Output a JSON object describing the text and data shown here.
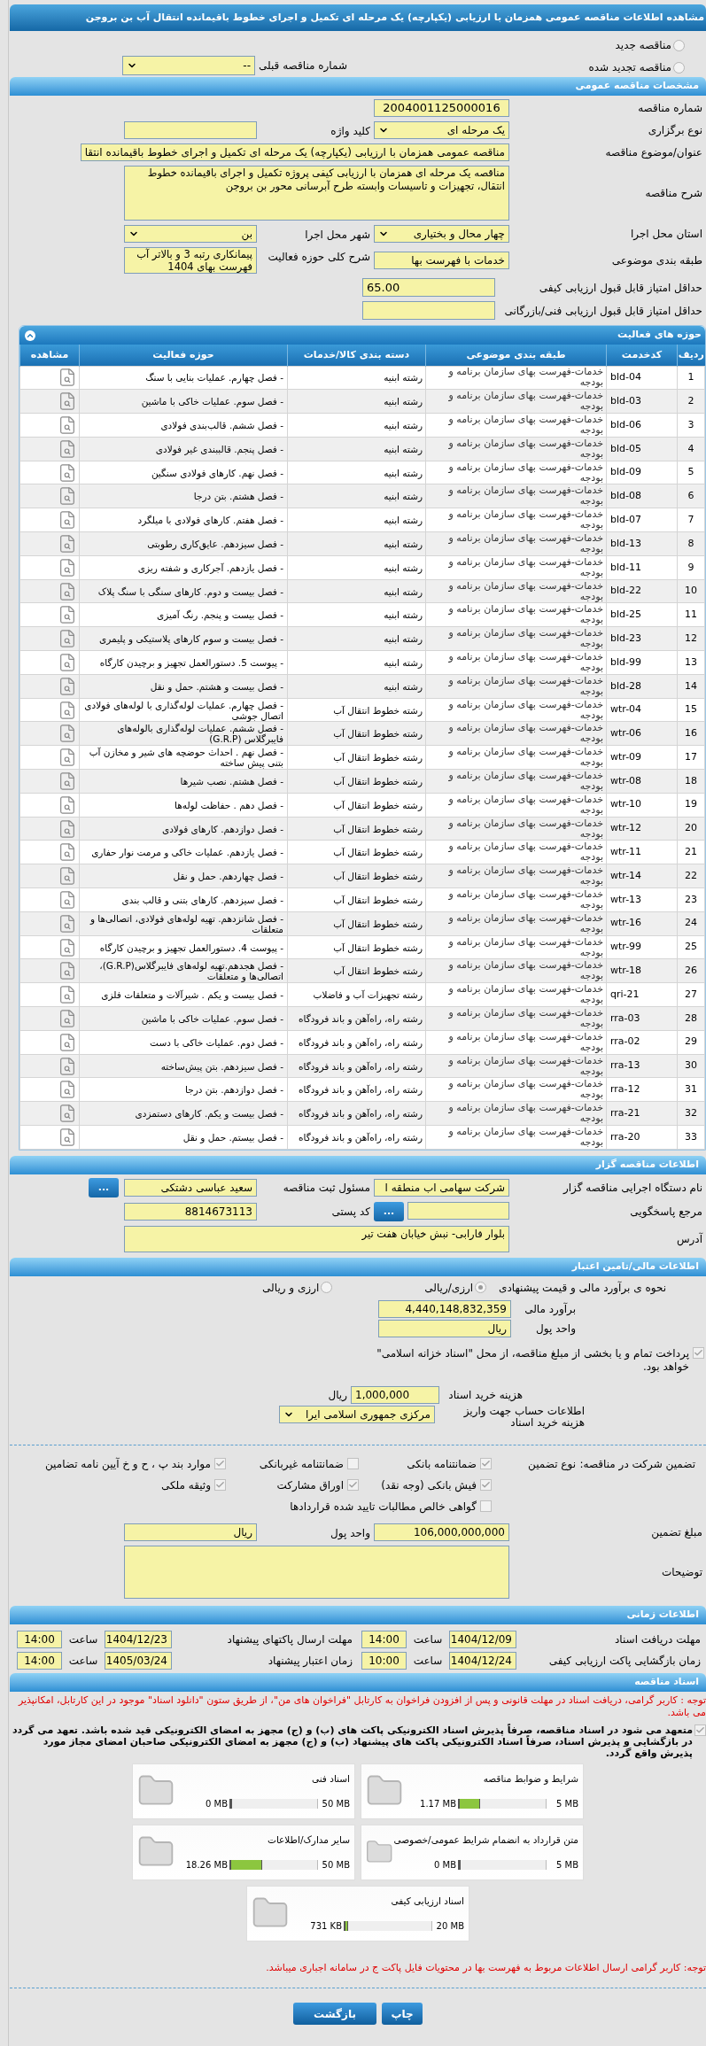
{
  "title": "مشاهده اطلاعات مناقصه عمومی همزمان با ارزیابی (یکپارچه) یک مرحله ای تکمیل و اجرای خطوط باقیمانده انتقال آب بن بروجن",
  "tender_type": [
    {
      "label": "مناقصه جدید",
      "selected": false
    },
    {
      "label": "مناقصه تجدید شده",
      "selected": false
    }
  ],
  "previous_tender": {
    "label": "شماره مناقصه قبلی",
    "value": "--"
  },
  "general": {
    "header": "مشخصات مناقصه عمومی",
    "rows": [
      [
        {
          "label": "شماره مناقصه",
          "kind": "code",
          "value": "2004001125000016"
        }
      ],
      [
        {
          "label": "نوع برگزاری",
          "kind": "select",
          "value": "یک مرحله ای"
        },
        {
          "label": "کلید واژه",
          "kind": "text"
        }
      ],
      [
        {
          "label": "عنوان/موضوع مناقصه",
          "kind": "long",
          "value": "مناقصه عمومی همزمان با ارزیابی (یکپارچه) یک مرحله ای تکمیل و اجرای خطوط باقیمانده انتقا"
        }
      ],
      [
        {
          "label": "شرح مناقصه",
          "kind": "textarea",
          "value": "مناقصه یک مرحله ای همزمان با ارزیابی کیفی پروژه تکمیل و اجرای باقیمانده خطوط انتقال، تجهیزات و تاسیسات وابسته طرح آبرسانی محور بن بروجن"
        }
      ],
      [
        {
          "label": "استان محل اجرا",
          "kind": "select",
          "value": "چهار محال و بختیاری"
        },
        {
          "label": "شهر محل اجرا",
          "kind": "select",
          "value": "بن"
        }
      ],
      [
        {
          "label": "طبقه بندی موضوعی",
          "kind": "text",
          "value": "خدمات با فهرست بها"
        },
        {
          "label": "شرح کلی حوزه فعالیت",
          "kind": "note",
          "value": "پیمانکاری رتبه 3 و بالاتر آب فهرست بهای 1404"
        }
      ],
      [
        {
          "label": "حداقل امتیاز قابل قبول ارزیابی کیفی",
          "kind": "score",
          "value": "65.00"
        }
      ],
      [
        {
          "label": "حداقل امتیاز قابل قبول ارزیابی فنی/بازرگانی",
          "kind": "score"
        }
      ]
    ]
  },
  "activities": {
    "header": "حوزه های فعالیت",
    "columns": [
      "ردیف",
      "کدخدمت",
      "طبقه بندی موضوعی",
      "دسته بندی کالا/خدمات",
      "حوزه فعالیت",
      "مشاهده"
    ],
    "rows": [
      [
        "1",
        "bld-04",
        "خدمات-فهرست بهای سازمان برنامه و بودجه",
        "رشته ابنیه",
        "- فصل چهارم. عملیات بنایی با سنگ"
      ],
      [
        "2",
        "bld-03",
        "خدمات-فهرست بهای سازمان برنامه و بودجه",
        "رشته ابنیه",
        "- فصل سوم. عملیات خاکی با ماشین"
      ],
      [
        "3",
        "bld-06",
        "خدمات-فهرست بهای سازمان برنامه و بودجه",
        "رشته ابنیه",
        "- فصل ششم. قالب‌بندی فولادی"
      ],
      [
        "4",
        "bld-05",
        "خدمات-فهرست بهای سازمان برنامه و بودجه",
        "رشته ابنیه",
        "- فصل پنجم. قالببندی غیر فولادی"
      ],
      [
        "5",
        "bld-09",
        "خدمات-فهرست بهای سازمان برنامه و بودجه",
        "رشته ابنیه",
        "- فصل نهم. کارهای فولادی سنگین"
      ],
      [
        "6",
        "bld-08",
        "خدمات-فهرست بهای سازمان برنامه و بودجه",
        "رشته ابنیه",
        "- فصل هشتم. بتن درجا"
      ],
      [
        "7",
        "bld-07",
        "خدمات-فهرست بهای سازمان برنامه و بودجه",
        "رشته ابنیه",
        "- فصل هفتم. کارهای فولادی با میلگرد"
      ],
      [
        "8",
        "bld-13",
        "خدمات-فهرست بهای سازمان برنامه و بودجه",
        "رشته ابنیه",
        "- فصل سیزدهم. عایق‌کاری رطوبتی"
      ],
      [
        "9",
        "bld-11",
        "خدمات-فهرست بهای سازمان برنامه و بودجه",
        "رشته ابنیه",
        "- فصل یازدهم. آجرکاری و شفته ریزی"
      ],
      [
        "10",
        "bld-22",
        "خدمات-فهرست بهای سازمان برنامه و بودجه",
        "رشته ابنیه",
        "- فصل بیست و دوم. کارهای سنگی با سنگ پلاک"
      ],
      [
        "11",
        "bld-25",
        "خدمات-فهرست بهای سازمان برنامه و بودجه",
        "رشته ابنیه",
        "- فصل بیست و پنجم. رنگ آمیزی"
      ],
      [
        "12",
        "bld-23",
        "خدمات-فهرست بهای سازمان برنامه و بودجه",
        "رشته ابنیه",
        "- فصل بیست و سوم کارهای پلاستیکی و پلیمری"
      ],
      [
        "13",
        "bld-99",
        "خدمات-فهرست بهای سازمان برنامه و بودجه",
        "رشته ابنیه",
        "- پیوست 5. دستورالعمل تجهیز و برچیدن کارگاه"
      ],
      [
        "14",
        "bld-28",
        "خدمات-فهرست بهای سازمان برنامه و بودجه",
        "رشته ابنیه",
        "- فصل بیست و هشتم. حمل و نقل"
      ],
      [
        "15",
        "wtr-04",
        "خدمات-فهرست بهای سازمان برنامه و بودجه",
        "رشته خطوط انتقال آب",
        "- فصل چهارم. عملیات لوله‌گذاری با لوله‌های فولادی اتصال جوشی"
      ],
      [
        "16",
        "wtr-06",
        "خدمات-فهرست بهای سازمان برنامه و بودجه",
        "رشته خطوط انتقال آب",
        "- فصل ششم. عملیات لوله‌گذاری بالوله‌های فایبرگلاس (G.R.P)"
      ],
      [
        "17",
        "wtr-09",
        "خدمات-فهرست بهای سازمان برنامه و بودجه",
        "رشته خطوط انتقال آب",
        "- فصل نهم . احداث حوضچه های شیر و مخازن آب بتنی پیش ساخته"
      ],
      [
        "18",
        "wtr-08",
        "خدمات-فهرست بهای سازمان برنامه و بودجه",
        "رشته خطوط انتقال آب",
        "- فصل هشتم. نصب شیرها"
      ],
      [
        "19",
        "wtr-10",
        "خدمات-فهرست بهای سازمان برنامه و بودجه",
        "رشته خطوط انتقال آب",
        "- فصل دهم . حفاظت لوله‌ها"
      ],
      [
        "20",
        "wtr-12",
        "خدمات-فهرست بهای سازمان برنامه و بودجه",
        "رشته خطوط انتقال آب",
        "- فصل دوازدهم. کارهای فولادی"
      ],
      [
        "21",
        "wtr-11",
        "خدمات-فهرست بهای سازمان برنامه و بودجه",
        "رشته خطوط انتقال آب",
        "- فصل یازدهم. عملیات خاکی و مرمت نوار حفاری"
      ],
      [
        "22",
        "wtr-14",
        "خدمات-فهرست بهای سازمان برنامه و بودجه",
        "رشته خطوط انتقال آب",
        "- فصل چهاردهم. حمل و نقل"
      ],
      [
        "23",
        "wtr-13",
        "خدمات-فهرست بهای سازمان برنامه و بودجه",
        "رشته خطوط انتقال آب",
        "- فصل سیزدهم. کارهای بتنی و قالب بندی"
      ],
      [
        "24",
        "wtr-16",
        "خدمات-فهرست بهای سازمان برنامه و بودجه",
        "رشته خطوط انتقال آب",
        "- فصل شانزدهم. تهیه لوله‌های فولادی، اتصالی‌ها و متعلقات"
      ],
      [
        "25",
        "wtr-99",
        "خدمات-فهرست بهای سازمان برنامه و بودجه",
        "رشته خطوط انتقال آب",
        "- پیوست 4. دستورالعمل تجهیز و برچیدن کارگاه"
      ],
      [
        "26",
        "wtr-18",
        "خدمات-فهرست بهای سازمان برنامه و بودجه",
        "رشته خطوط انتقال آب",
        "- فصل هجدهم.تهیه لوله‌های فایبرگلاس(G.R.P)، اتصالی‌ها و متعلقات"
      ],
      [
        "27",
        "qri-21",
        "خدمات-فهرست بهای سازمان برنامه و بودجه",
        "رشته تجهیزات آب و فاضلاب",
        "- فصل بیست و یکم . شیرآلات و متعلقات فلزی"
      ],
      [
        "28",
        "rra-03",
        "خدمات-فهرست بهای سازمان برنامه و بودجه",
        "رشته راه، راه‌آهن و باند فرودگاه",
        "- فصل سوم. عملیات خاکی با ماشین"
      ],
      [
        "29",
        "rra-02",
        "خدمات-فهرست بهای سازمان برنامه و بودجه",
        "رشته راه، راه‌آهن و باند فرودگاه",
        "- فصل دوم. عملیات خاکی با دست"
      ],
      [
        "30",
        "rra-13",
        "خدمات-فهرست بهای سازمان برنامه و بودجه",
        "رشته راه، راه‌آهن و باند فرودگاه",
        "- فصل سیزدهم. بتن پیش‌ساخته"
      ],
      [
        "31",
        "rra-12",
        "خدمات-فهرست بهای سازمان برنامه و بودجه",
        "رشته راه، راه‌آهن و باند فرودگاه",
        "- فصل دوازدهم. بتن درجا"
      ],
      [
        "32",
        "rra-21",
        "خدمات-فهرست بهای سازمان برنامه و بودجه",
        "رشته راه، راه‌آهن و باند فرودگاه",
        "- فصل بیست و یکم. کارهای دستمزدی"
      ],
      [
        "33",
        "rra-20",
        "خدمات-فهرست بهای سازمان برنامه و بودجه",
        "رشته راه، راه‌آهن و باند فرودگاه",
        "- فصل بیستم. حمل و نقل"
      ]
    ]
  },
  "tenderer": {
    "header": "اطلاعات مناقصه گزار",
    "rows": [
      [
        {
          "label": "نام دستگاه اجرایی مناقصه گزار",
          "kind": "text",
          "value": "شرکت سهامی اب منطقه ا"
        },
        {
          "label": "مسئول ثبت مناقصه",
          "kind": "text",
          "value": "سعید عباسی دشتکی",
          "button": "..."
        }
      ],
      [
        {
          "label": "مرجع پاسخگویی",
          "kind": "text",
          "button": "..."
        },
        {
          "label": "کد پستی",
          "kind": "text",
          "value": "8814673113"
        }
      ],
      [
        {
          "label": "آدرس",
          "kind": "address",
          "value": "بلوار فارابی- نبش خیابان هفت تیر"
        }
      ]
    ]
  },
  "finance": {
    "header": "اطلاعات مالی/تامین اعتبار",
    "estimate_method": {
      "label": "نحوه ی برآورد مالی و قیمت پیشنهادی",
      "options": [
        {
          "label": "ارزی/ریالی",
          "selected": true
        },
        {
          "label": "ارزی و ریالی",
          "selected": false
        }
      ]
    },
    "estimate": {
      "label": "برآورد مالی",
      "value": "4,440,148,832,359"
    },
    "currency": {
      "label": "واحد پول",
      "value": "ریال"
    },
    "treasury": {
      "label": "پرداخت تمام و یا بخشی از مبلغ مناقصه، از محل \"اسناد خزانه اسلامی\" خواهد بود.",
      "checked": true
    },
    "doc_fee": {
      "label": "هزینه خرید اسناد",
      "value": "1,000,000",
      "unit": "ریال"
    },
    "account": {
      "label": "اطلاعات حساب جهت واریز هزینه خرید اسناد",
      "value": "مرکزی جمهوری اسلامی ایرا"
    }
  },
  "guarantee": {
    "label": "تضمین شرکت در مناقصه:",
    "type_label": "نوع تضمین",
    "options": [
      {
        "label": "ضمانتنامه بانکی",
        "checked": true
      },
      {
        "label": "ضمانتنامه غیربانکی",
        "checked": false
      },
      {
        "label": "موارد بند پ ، ح و خ آیین نامه تضامین",
        "checked": true
      },
      {
        "label": "فیش بانکی (وجه نقد)",
        "checked": true
      },
      {
        "label": "اوراق مشارکت",
        "checked": true
      },
      {
        "label": "وثیقه ملکی",
        "checked": true
      },
      {
        "label": "گواهی خالص مطالبات تایید شده قراردادها",
        "checked": false
      }
    ],
    "rows": [
      [
        {
          "label": "مبلغ تضمین",
          "kind": "text",
          "value": "106,000,000,000"
        },
        {
          "label": "واحد پول",
          "kind": "text",
          "value": "ریال"
        }
      ],
      [
        {
          "label": "توضیحات",
          "kind": "comments"
        }
      ]
    ]
  },
  "timing": {
    "header": "اطلاعات زمانی",
    "items": [
      {
        "label": "مهلت دریافت اسناد",
        "date": "1404/12/09",
        "time_label": "ساعت",
        "time": "14:00"
      },
      {
        "label": "مهلت ارسال پاکتهای پیشنهاد",
        "date": "1404/12/23",
        "time_label": "ساعت",
        "time": "14:00"
      },
      {
        "label": "زمان بازگشایی پاکت ارزیابی کیفی",
        "date": "1404/12/24",
        "time_label": "ساعت",
        "time": "10:00"
      },
      {
        "label": "زمان اعتبار پیشنهاد",
        "date": "1405/03/24",
        "time_label": "ساعت",
        "time": "14:00"
      }
    ]
  },
  "documents": {
    "header": "اسناد مناقصه",
    "notice": "توجه : کاربر گرامی، دریافت اسناد در مهلت قانونی و پس از افزودن فراخوان به کارتابل \"فراخوان های من\"، از طریق ستون \"دانلود اسناد\" موجود در این کارتابل، امکانپذیر می باشد.",
    "commitment": {
      "text": "متعهد می شود در اسناد مناقصه، صرفاً پذیرش اسناد الکترونیکی پاکت های (ب) و (ج) مجهز به امضای الکترونیکی قید شده باشد. تعهد می گردد در بازگشایی و پذیرش اسناد، صرفاً اسناد الکترونیکی پاکت های پیشنهاد (ب) و (ج) مجهز به امضای الکترونیکی صاحبان امضای مجاز مورد پذیرش واقع گردد.",
      "checked": true
    },
    "files": [
      {
        "name": "شرایط و ضوابط مناقصه",
        "max": "5 MB",
        "used": "1.17 MB",
        "level": 0.234
      },
      {
        "name": "اسناد فنی",
        "max": "50 MB",
        "used": "0 MB",
        "level": 0
      },
      {
        "name": "متن قرارداد به انضمام شرایط عمومی/خصوصی",
        "max": "5 MB",
        "used": "0 MB",
        "level": 0
      },
      {
        "name": "سایر مدارک/اطلاعات",
        "max": "50 MB",
        "used": "18.26 MB",
        "level": 0.365
      },
      {
        "name": "اسناد ارزیابی کیفی",
        "max": "20 MB",
        "used": "731 KB",
        "level": 0.036
      }
    ],
    "footnote": "توجه: کاربر گرامی ارسال اطلاعات مربوط به فهرست بها در محتویات فایل پاکت ج در سامانه اجباری میباشد."
  },
  "buttons": [
    "چاپ",
    "بازگشت"
  ]
}
